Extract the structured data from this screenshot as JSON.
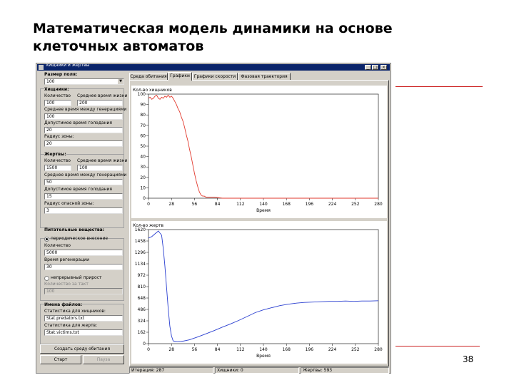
{
  "slide": {
    "title_line1": "Математическая модель динамики на основе",
    "title_line2": "клеточных автоматов",
    "page_number": "38"
  },
  "window": {
    "title": "Хищники и жертвы",
    "buttons": {
      "minimize": "_",
      "maximize": "□",
      "close": "×"
    }
  },
  "left_panel": {
    "field_size_label": "Размер поля:",
    "field_size_value": "100",
    "predators_heading": "Хищники:",
    "pred_count_label": "Количество",
    "pred_avg_life_label": "Среднее время жизни",
    "pred_count": "100",
    "pred_avg_life": "200",
    "pred_avg_gen_label": "Среднее время между генерациями",
    "pred_avg_gen": "100",
    "pred_hunger_label": "Допустимое время голодания",
    "pred_hunger": "20",
    "pred_zone_label": "Радиус зоны:",
    "pred_zone": "20",
    "prey_heading": "Жертвы:",
    "prey_count_label": "Количество",
    "prey_avg_life_label": "Среднее время жизни",
    "prey_count": "1500",
    "prey_avg_life": "100",
    "prey_avg_gen_label": "Среднее время между генерациями",
    "prey_avg_gen": "50",
    "prey_hunger_label": "Допустимое время голодания",
    "prey_hunger": "15",
    "prey_danger_label": "Радиус опасной зоны:",
    "prey_danger": "3",
    "nutrients_heading": "Питательные вещества:",
    "periodic_label": "периодическое внесение",
    "nutr_count_label": "Количество",
    "nutr_count": "5000",
    "nutr_regen_label": "Время регенерации",
    "nutr_regen": "30",
    "noninterrupt_label": "непрерывный прирост",
    "nutr_per_tick_label": "Количество за такт",
    "nutr_per_tick": "100",
    "files_heading": "Имена файлов:",
    "stats_pred_label": "Статистика для хищников:",
    "stats_pred_file": "Stat.predators.txt",
    "stats_prey_label": "Статистика для жертв:",
    "stats_prey_file": "Stat.victims.txt",
    "create_env_button": "Создать среду обитания",
    "start_button": "Старт",
    "pause_button": "Пауза"
  },
  "tabs": [
    {
      "label": "Среда обитания"
    },
    {
      "label": "Графики"
    },
    {
      "label": "Графики скорости"
    },
    {
      "label": "Фазовая траектория"
    }
  ],
  "statusbar": {
    "iteration": "Итерация: 287",
    "predators": "Хищники: 0",
    "prey": "Жертвы: 593"
  },
  "colors": {
    "predator_line": "#e23a2e",
    "prey_line": "#2a3fd0",
    "title_bar": "#0a246a",
    "accent_rule": "#cc2222"
  },
  "chart_data": [
    {
      "type": "line",
      "title": "Кол-во хищников",
      "xlabel": "Время",
      "ylabel": "",
      "xlim": [
        0,
        280
      ],
      "ylim": [
        0,
        100
      ],
      "x_ticks": [
        "0",
        "28",
        "56",
        "84",
        "112",
        "140",
        "168",
        "196",
        "224",
        "252",
        "280"
      ],
      "y_ticks": [
        "0",
        "10",
        "20",
        "30",
        "40",
        "50",
        "60",
        "70",
        "80",
        "90",
        "100"
      ],
      "series": [
        {
          "x": [
            0,
            2,
            4,
            6,
            8,
            10,
            12,
            14,
            16,
            18,
            20,
            22,
            24,
            26,
            28,
            30,
            32,
            34,
            36,
            38,
            40,
            42,
            44,
            46,
            48,
            50,
            52,
            54,
            56,
            58,
            60,
            62,
            64,
            66,
            68,
            70,
            75,
            80,
            90,
            100,
            110,
            120,
            130,
            140,
            150,
            160,
            170,
            180,
            190,
            200,
            220,
            240,
            260,
            280
          ],
          "y": [
            96,
            97,
            95,
            96,
            98,
            99,
            96,
            95,
            97,
            96,
            98,
            97,
            99,
            97,
            98,
            96,
            93,
            90,
            86,
            83,
            78,
            74,
            68,
            61,
            55,
            47,
            40,
            32,
            24,
            17,
            11,
            6,
            3,
            2,
            2,
            1,
            1,
            1,
            0,
            0,
            0,
            0,
            0,
            0,
            0,
            0,
            0,
            0,
            0,
            0,
            0,
            0,
            0,
            0
          ]
        }
      ]
    },
    {
      "type": "line",
      "title": "Кол-во жертв",
      "xlabel": "Время",
      "ylabel": "",
      "xlim": [
        0,
        280
      ],
      "ylim": [
        0,
        1620
      ],
      "x_ticks": [
        "0",
        "28",
        "56",
        "84",
        "112",
        "140",
        "168",
        "196",
        "224",
        "252",
        "280"
      ],
      "y_ticks": [
        "0",
        "162",
        "324",
        "486",
        "648",
        "810",
        "972",
        "1134",
        "1296",
        "1458",
        "1620"
      ],
      "series": [
        {
          "x": [
            0,
            4,
            8,
            12,
            16,
            18,
            20,
            22,
            24,
            26,
            28,
            30,
            32,
            35,
            40,
            50,
            60,
            70,
            80,
            90,
            100,
            110,
            120,
            130,
            140,
            150,
            160,
            170,
            180,
            190,
            200,
            210,
            220,
            230,
            240,
            250,
            260,
            270,
            280
          ],
          "y": [
            1500,
            1520,
            1560,
            1600,
            1540,
            1350,
            1100,
            800,
            500,
            250,
            110,
            40,
            30,
            28,
            30,
            55,
            95,
            140,
            185,
            235,
            280,
            330,
            385,
            440,
            480,
            510,
            540,
            560,
            575,
            585,
            590,
            595,
            600,
            600,
            605,
            600,
            605,
            605,
            610
          ]
        }
      ]
    }
  ]
}
